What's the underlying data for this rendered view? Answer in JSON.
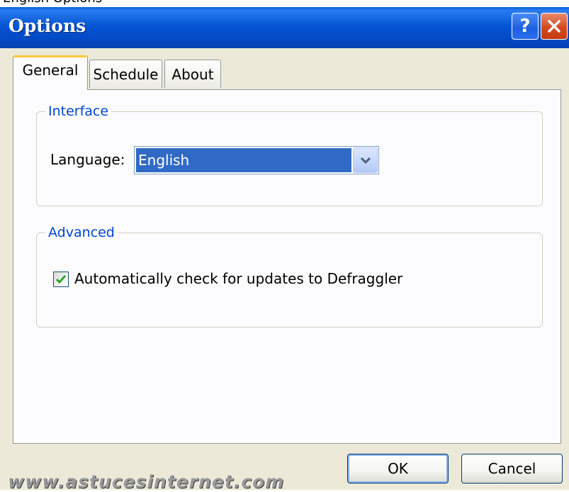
{
  "header_cut": {
    "text": "English Options"
  },
  "window": {
    "title": "Options"
  },
  "title_buttons": {
    "help": "?"
  },
  "tabs": [
    {
      "label": "General",
      "active": true
    },
    {
      "label": "Schedule",
      "active": false
    },
    {
      "label": "About",
      "active": false
    }
  ],
  "interface": {
    "group_label": "Interface",
    "language_label": "Language:",
    "language_value": "English"
  },
  "advanced": {
    "group_label": "Advanced",
    "auto_update_label": "Automatically check for updates to Defraggler",
    "auto_update_checked": true
  },
  "buttons": {
    "ok": "OK",
    "cancel": "Cancel"
  },
  "watermark": "www.astucesinternet.com",
  "colors": {
    "titlebar": "#0556d4",
    "selection": "#316ac5",
    "group_label": "#0046d5",
    "active_tab_accent": "#ffc83c",
    "close_button": "#d44a1d"
  },
  "icons": [
    "help-icon",
    "close-icon",
    "chevron-down-icon",
    "checkmark-icon"
  ]
}
